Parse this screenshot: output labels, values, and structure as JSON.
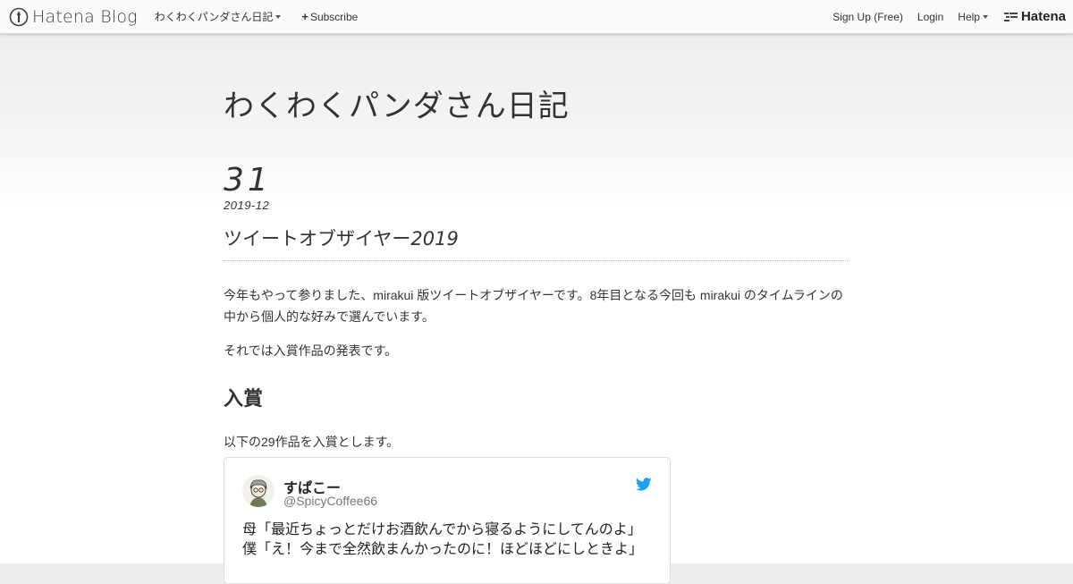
{
  "topbar": {
    "brand": "Hatena Blog",
    "blog_menu": "わくわくパンダさん日記",
    "subscribe": "Subscribe",
    "signup": "Sign Up (Free)",
    "login": "Login",
    "help": "Help",
    "hatena": "Hatena"
  },
  "blog": {
    "title": "わくわくパンダさん日記"
  },
  "entry": {
    "date_day": "31",
    "date_ym": "2019-12",
    "title_text": "ツイートオブザイヤー",
    "title_year": "2019",
    "paragraph1": "今年もやって参りました、mirakui 版ツイートオブザイヤーです。8年目となる今回も mirakui のタイムラインの中から個人的な好みで選んでいます。",
    "paragraph2": "それでは入賞作品の発表です。",
    "heading": "入賞",
    "paragraph3": "以下の29作品を入賞とします。"
  },
  "tweet": {
    "name": "すぱこー",
    "handle": "@SpicyCoffee66",
    "body": "母「最近ちょっとだけお酒飲んでから寝るようにしてんのよ」\n僕「え！今まで全然飲まんかったのに！ほどほどにしときよ」"
  },
  "colors": {
    "twitter_blue": "#1da1f2",
    "text": "#333333",
    "border": "#dcdcdc"
  }
}
